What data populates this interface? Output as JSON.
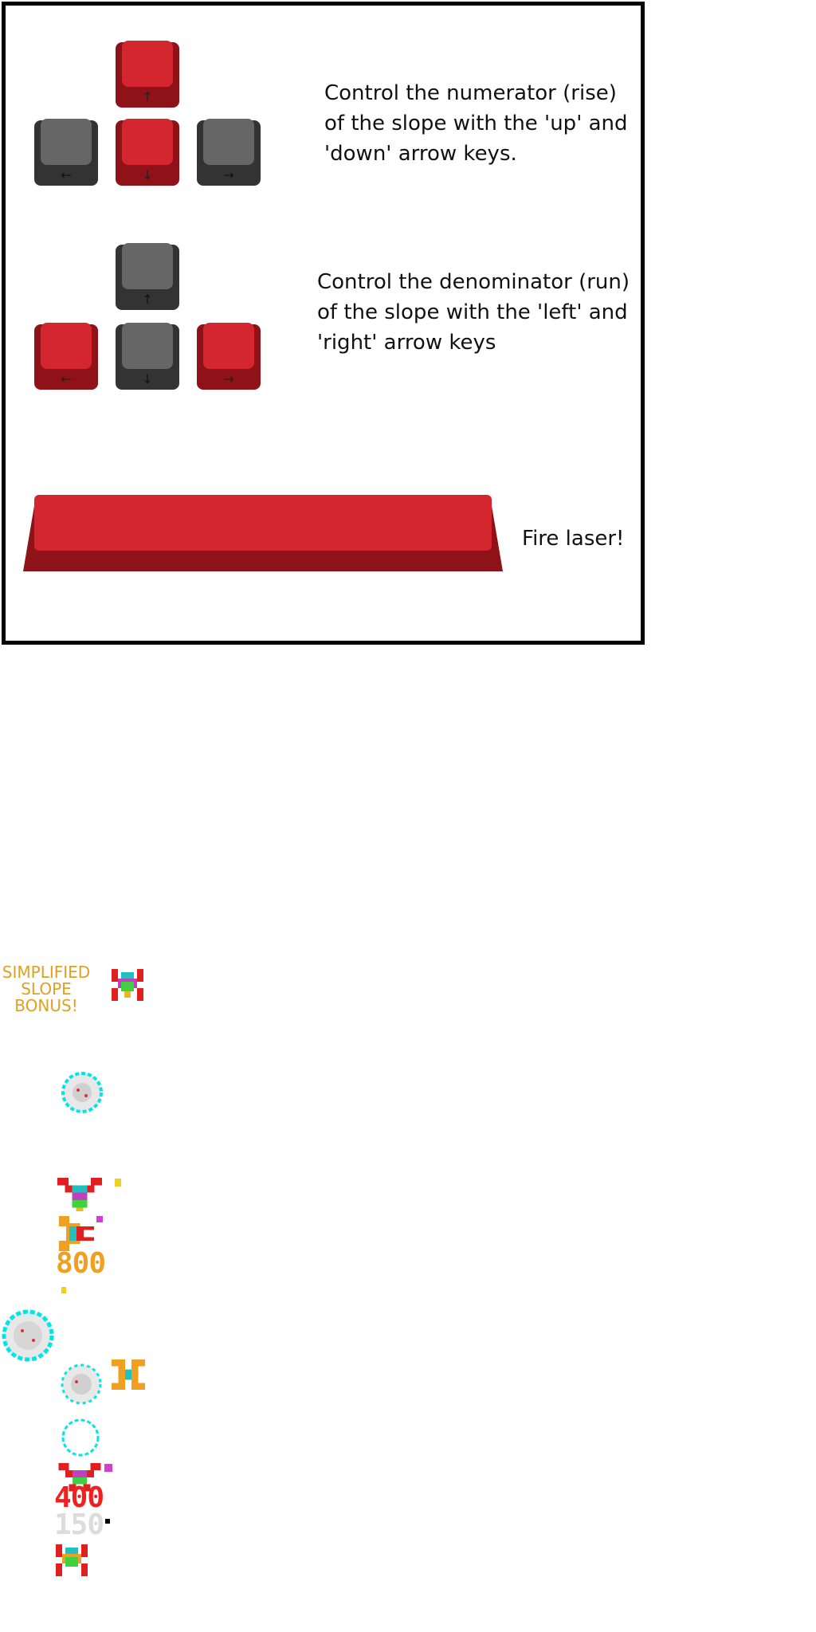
{
  "instructions": {
    "rise_text": "Control the numerator (rise)\nof the slope with the 'up' and\n'down' arrow keys.",
    "run_text": "Control the denominator (run)\nof the slope with the 'left' and\n'right' arrow keys",
    "fire_text": "Fire laser!"
  },
  "keys": {
    "up": "↑",
    "down": "↓",
    "left": "←",
    "right": "→"
  },
  "sprites": {
    "bonus_text": "SIMPLIFIED\nSLOPE\nBONUS!",
    "score_800": "800",
    "score_400": "400",
    "score_150": "150"
  },
  "colors": {
    "key_active": "#c8202a",
    "key_inactive": "#555555",
    "bonus": "#e0a020",
    "explosion": "#00e5e5"
  }
}
